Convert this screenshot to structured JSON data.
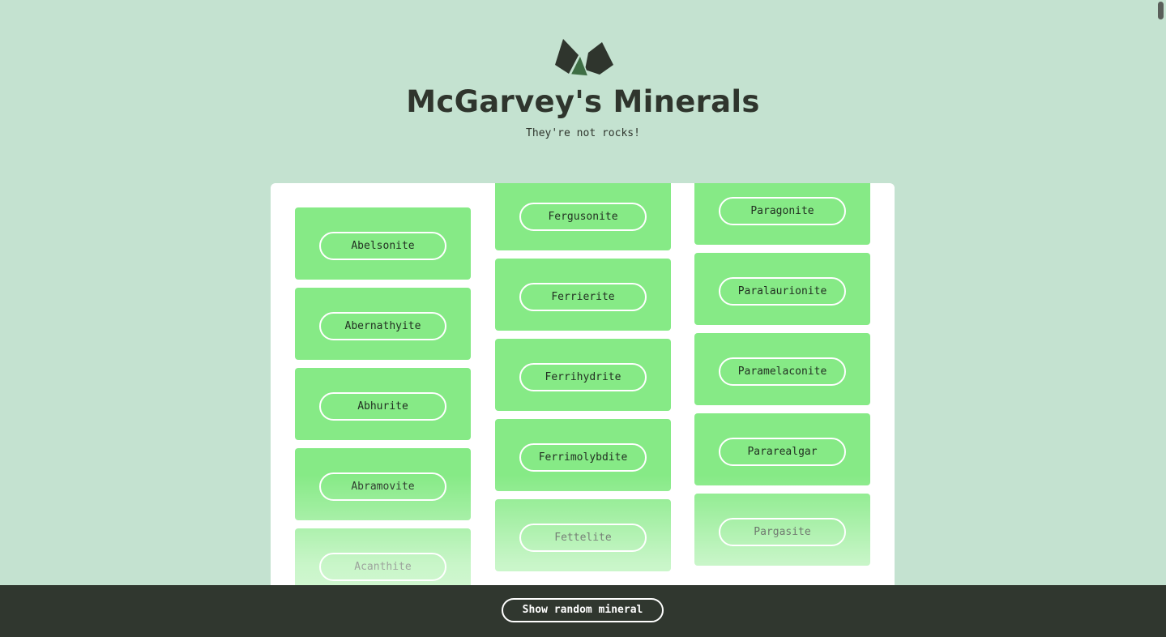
{
  "header": {
    "title": "McGarvey's Minerals",
    "tagline": "They're not rocks!",
    "logo_icon": "crystals-logo-icon"
  },
  "colors": {
    "background": "#c4e2d0",
    "panel": "#ffffff",
    "card": "#86ea86",
    "text_dark": "#2f352d",
    "footer": "#30372f",
    "logo_dark": "#2f352d",
    "logo_accent": "#3e6e44"
  },
  "minerals": {
    "column1": [
      "Abelsonite",
      "Abernathyite",
      "Abhurite",
      "Abramovite",
      "Acanthite"
    ],
    "column2": [
      "Fergusonite",
      "Ferrierite",
      "Ferrihydrite",
      "Ferrimolybdite",
      "Fettelite"
    ],
    "column3": [
      "Paragonite",
      "Paralaurionite",
      "Paramelaconite",
      "Pararealgar",
      "Pargasite"
    ]
  },
  "footer": {
    "random_button_label": "Show random mineral"
  }
}
